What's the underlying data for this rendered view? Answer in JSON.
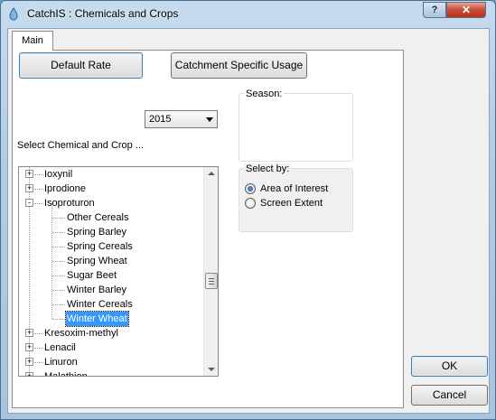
{
  "window": {
    "title": "CatchIS : Chemicals and Crops",
    "help_label": "?",
    "close_label": "✕"
  },
  "tabs": [
    {
      "label": "Main"
    }
  ],
  "buttons": {
    "default_rate": "Default Rate",
    "catchment_usage": "Catchment Specific Usage",
    "ok": "OK",
    "cancel": "Cancel"
  },
  "year_select": {
    "value": "2015"
  },
  "chemical_label": "Select Chemical and Crop ...",
  "season": {
    "label": "Season:"
  },
  "select_by": {
    "label": "Select by:",
    "options": [
      {
        "label": "Area of Interest",
        "checked": true
      },
      {
        "label": "Screen Extent",
        "checked": false
      }
    ]
  },
  "tree": {
    "items": [
      {
        "label": "Ioxynil",
        "expander": "+",
        "level": 0
      },
      {
        "label": "Iprodione",
        "expander": "+",
        "level": 0
      },
      {
        "label": "Isoproturon",
        "expander": "-",
        "level": 0
      },
      {
        "label": "Other Cereals",
        "level": 1
      },
      {
        "label": "Spring Barley",
        "level": 1
      },
      {
        "label": "Spring Cereals",
        "level": 1
      },
      {
        "label": "Spring Wheat",
        "level": 1
      },
      {
        "label": "Sugar Beet",
        "level": 1
      },
      {
        "label": "Winter Barley",
        "level": 1
      },
      {
        "label": "Winter Cereals",
        "level": 1
      },
      {
        "label": "Winter Wheat",
        "level": 1,
        "selected": true
      },
      {
        "label": "Kresoxim-methyl",
        "expander": "+",
        "level": 0
      },
      {
        "label": "Lenacil",
        "expander": "+",
        "level": 0
      },
      {
        "label": "Linuron",
        "expander": "+",
        "level": 0
      },
      {
        "label": "Malathion",
        "expander": "+",
        "level": 0
      }
    ]
  },
  "colors": {
    "accent": "#3399ff",
    "titlebar": "#b2cbe3",
    "close": "#c9503a"
  }
}
